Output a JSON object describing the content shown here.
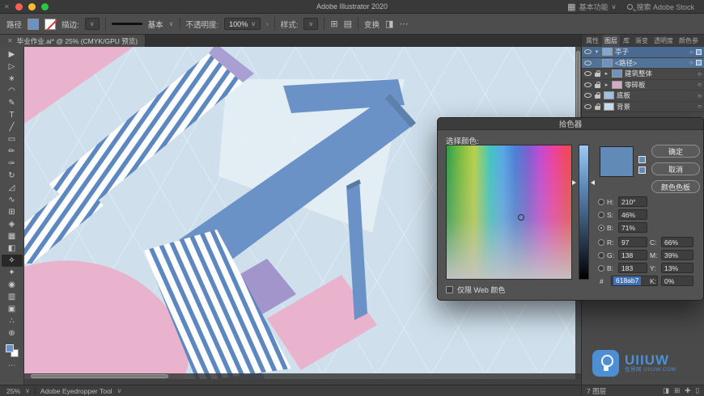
{
  "titlebar": {
    "close_icon": "✕",
    "title": "Adobe Illustrator 2020",
    "workspace_label": "基本功能",
    "search_label": "搜索 Adobe Stock"
  },
  "control_bar": {
    "context_label": "路径",
    "fill_color": "#6a92c7",
    "stroke_label": "描边:",
    "brush_name": "基本",
    "opacity_label": "不透明度:",
    "opacity_value": "100%",
    "style_label": "样式:",
    "transform_label": "变换",
    "more_icon": "⋯"
  },
  "document_tab": {
    "close": "✕",
    "title": "毕业作业.ai* @ 25% (CMYK/GPU 预览)"
  },
  "tools": [
    {
      "name": "selection",
      "glyph": "▶"
    },
    {
      "name": "direct-selection",
      "glyph": "▷"
    },
    {
      "name": "magic-wand",
      "glyph": "∗"
    },
    {
      "name": "lasso",
      "glyph": "◠"
    },
    {
      "name": "pen",
      "glyph": "✎"
    },
    {
      "name": "type",
      "glyph": "T"
    },
    {
      "name": "line-segment",
      "glyph": "╱"
    },
    {
      "name": "rectangle",
      "glyph": "▭"
    },
    {
      "name": "paintbrush",
      "glyph": "✏"
    },
    {
      "name": "shaper",
      "glyph": "✑"
    },
    {
      "name": "rotate",
      "glyph": "↻"
    },
    {
      "name": "scale",
      "glyph": "◿"
    },
    {
      "name": "width",
      "glyph": "∿"
    },
    {
      "name": "free-transform",
      "glyph": "⊞"
    },
    {
      "name": "shape-builder",
      "glyph": "◈"
    },
    {
      "name": "mesh",
      "glyph": "▦"
    },
    {
      "name": "gradient",
      "glyph": "◧"
    },
    {
      "name": "eyedropper",
      "glyph": "✧"
    },
    {
      "name": "blend",
      "glyph": "✦"
    },
    {
      "name": "symbol-sprayer",
      "glyph": "◉"
    },
    {
      "name": "column-graph",
      "glyph": "▥"
    },
    {
      "name": "artboard",
      "glyph": "▣"
    },
    {
      "name": "hand",
      "glyph": "∴"
    },
    {
      "name": "zoom",
      "glyph": "⊕"
    }
  ],
  "canvas": {
    "background": "#cfe0ec",
    "artwork_colors": {
      "blue": "#6a92c7",
      "pink": "#e9b3cd",
      "purple": "#a195cb",
      "stripe_blue": "#5d87c0",
      "light_face": "#e6eff6"
    }
  },
  "layers_panel": {
    "tabs": [
      {
        "label": "属性"
      },
      {
        "label": "图层"
      },
      {
        "label": "库"
      },
      {
        "label": "渐变"
      },
      {
        "label": "透明度"
      },
      {
        "label": "颜色参"
      }
    ],
    "rows": [
      {
        "name": "亭子",
        "thumb": "#7fa8d9"
      },
      {
        "name": "<路径>",
        "thumb": "#6a92c7"
      },
      {
        "name": "建筑整体",
        "thumb": "#6a92c7"
      },
      {
        "name": "零碎板",
        "thumb": "#d9a8c4"
      },
      {
        "name": "底板",
        "thumb": "#9fc0e0"
      },
      {
        "name": "背景",
        "thumb": "#cfe0ec"
      }
    ],
    "footer": "7 图层"
  },
  "color_picker": {
    "title": "拾色器",
    "prompt": "选择颜色:",
    "buttons": {
      "ok": "确定",
      "cancel": "取消",
      "swatches": "颜色色板"
    },
    "hsb": [
      {
        "label": "H:",
        "value": "210°"
      },
      {
        "label": "S:",
        "value": "46%"
      },
      {
        "label": "B:",
        "value": "71%"
      }
    ],
    "rgb": [
      {
        "label": "R:",
        "value": "97"
      },
      {
        "label": "G:",
        "value": "138"
      },
      {
        "label": "B:",
        "value": "183"
      }
    ],
    "cmyk": [
      {
        "label": "C:",
        "value": "66%"
      },
      {
        "label": "M:",
        "value": "39%"
      },
      {
        "label": "Y:",
        "value": "13%"
      },
      {
        "label": "K:",
        "value": "0%"
      }
    ],
    "hex_prefix": "#",
    "hex_value": "618ab7",
    "web_only_label": "仅限 Web 颜色",
    "current_color": "#618ab7"
  },
  "status_bar": {
    "zoom": "25%",
    "tool_name": "Adobe Eyedropper Tool"
  },
  "watermark": {
    "brand": "UIIUW",
    "subtitle": "优界网 UIIUW.COM"
  },
  "icons": {
    "caret_down": "▾",
    "caret_right": "▸",
    "chevron_down": "∨",
    "chevron_right": "›",
    "target": "○",
    "grid": "⊞",
    "rows": "▤",
    "panel": "◨",
    "plus": "✚",
    "sheet": "▯"
  }
}
